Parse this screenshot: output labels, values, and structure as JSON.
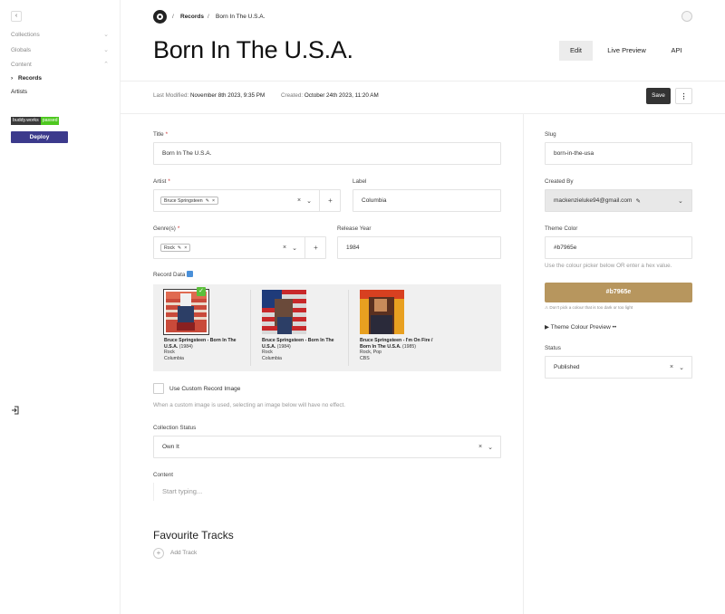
{
  "sidebar": {
    "collapse_icon": "‹",
    "groups": [
      {
        "label": "Collections",
        "icon": "chevron-down"
      },
      {
        "label": "Globals",
        "icon": "chevron-down"
      },
      {
        "label": "Content",
        "icon": "chevron-up"
      }
    ],
    "items": [
      {
        "label": "Records",
        "active": true
      },
      {
        "label": "Artists",
        "active": false
      }
    ],
    "badge": {
      "left": "buddy.works",
      "right": "passed"
    },
    "deploy_label": "Deploy"
  },
  "header": {
    "breadcrumbs": [
      "Records",
      "Born In The U.S.A."
    ],
    "separator": "/",
    "title": "Born In The U.S.A.",
    "buttons": {
      "edit": "Edit",
      "live_preview": "Live Preview",
      "api": "API"
    }
  },
  "meta": {
    "modified_label": "Last Modified:",
    "modified_value": "November 8th 2023, 9:35 PM",
    "created_label": "Created:",
    "created_value": "October 24th 2023, 11:20 AM",
    "save_label": "Save",
    "more_icon": "⋮"
  },
  "form": {
    "title": {
      "label": "Title",
      "required": "*",
      "value": "Born In The U.S.A."
    },
    "artist": {
      "label": "Artist",
      "required": "*",
      "tag": "Bruce Springsteen"
    },
    "label_field": {
      "label": "Label",
      "value": "Columbia"
    },
    "genres": {
      "label": "Genre(s)",
      "required": "*",
      "tag": "Rock"
    },
    "release_year": {
      "label": "Release Year",
      "value": "1984"
    },
    "record_data": {
      "label": "Record Data",
      "records": [
        {
          "title": "Bruce Springsteen - Born In The U.S.A.",
          "year": "(1984)",
          "genre": "Rock",
          "label": "Columbia",
          "selected": true
        },
        {
          "title": "Bruce Springsteen - Born In The U.S.A.",
          "year": "(1984)",
          "genre": "Rock",
          "label": "Columbia",
          "selected": false
        },
        {
          "title": "Bruce Springsteen - I'm On Fire / Born In The U.S.A.",
          "year": "(1985)",
          "genre": "Rock, Pop",
          "label": "CBS",
          "selected": false
        }
      ]
    },
    "custom_image": {
      "label": "Use Custom Record Image",
      "help": "When a custom image is used, selecting an image below will have no effect."
    },
    "collection_status": {
      "label": "Collection Status",
      "value": "Own It"
    },
    "content": {
      "label": "Content",
      "placeholder": "Start typing..."
    },
    "favourite_tracks": {
      "title": "Favourite Tracks",
      "add_label": "Add Track"
    }
  },
  "side": {
    "slug": {
      "label": "Slug",
      "value": "born-in-the-usa"
    },
    "created_by": {
      "label": "Created By",
      "value": "mackenzieluke94@gmail.com"
    },
    "theme_color": {
      "label": "Theme Color",
      "value": "#b7965e",
      "help": "Use the colour picker below OR enter a hex value.",
      "button_label": "#b7965e",
      "warning": "⚠ Don't pick a colour that is too dark or too light",
      "preview_label": "▶ Theme Colour Preview ••"
    },
    "status": {
      "label": "Status",
      "value": "Published"
    }
  },
  "colors": {
    "accent": "#b7965e",
    "deploy": "#3c3a8c",
    "save": "#333333",
    "badge_green": "#4ec820"
  }
}
